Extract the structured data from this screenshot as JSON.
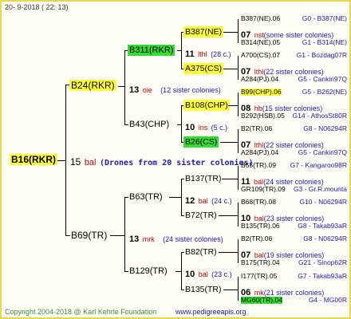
{
  "header": {
    "text": "20-   9-2018 (  22:  13)"
  },
  "footer": {
    "copyright": "Copyright 2004-2018 @ Karl Kehrle Foundation",
    "site": "www.pedigreeapis.org"
  },
  "root": {
    "name": "B16(RKR)",
    "num": "15",
    "code": "bal",
    "note": "(Drones from 20 sister colonies)"
  },
  "gen1": [
    {
      "name": "B24(RKR)",
      "num": "13",
      "code": "oie",
      "note": "(12 sister colonies)"
    },
    {
      "name": "B69(TR)",
      "num": "13",
      "code": "mrk",
      "note": "(24 sister colonies)"
    }
  ],
  "gen2": [
    {
      "name": "B311(RKR)",
      "num": "11",
      "code": "lthl",
      "note": "(28 c.)"
    },
    {
      "name": "B43(CHP)",
      "num": "10",
      "code": "ins",
      "note": "(5 c.)"
    },
    {
      "name": "B63(TR)",
      "num": "12",
      "code": "bal",
      "note": "(24 c.)"
    },
    {
      "name": "B129(TR)",
      "num": "10",
      "code": "bal",
      "note": "(23 c.)"
    }
  ],
  "gen3": [
    {
      "name": "B387(NE)"
    },
    {
      "name": "A375(CS)"
    },
    {
      "name": "B108(CHP)"
    },
    {
      "name": "B26(CS)"
    },
    {
      "name": "B137(TR)"
    },
    {
      "name": "B72(TR)"
    },
    {
      "name": "B82(TR)"
    },
    {
      "name": "B135(TR)"
    }
  ],
  "gen4": [
    {
      "top": "B387(NE).06",
      "topg": "G0 - B387(NE)",
      "num": "07",
      "code": "nst",
      "note": "(some sister colonies)",
      "bot": "B314(NE).05",
      "botg": "G1 - B314(NE)"
    },
    {
      "top": "A700(CS).07",
      "topg": "G1 - Bozdag07R",
      "num": "07",
      "code": "lthl",
      "note": "(22 sister colonies)",
      "bot": "A284(PJ).04",
      "botg": "G5 - Cankiri97Q"
    },
    {
      "top": "B99(CHP).06",
      "topg": "G5 - B262(NE)",
      "num": "08",
      "code": "hb",
      "note": "(15 sister colonies)",
      "bot": "B292(HSB).05",
      "botg": "G14 - AthosSt80R"
    },
    {
      "top": "B2(TR).06",
      "topg": "G8 - N06294R",
      "num": "07",
      "code": "lthl",
      "note": "(22 sister colonies)",
      "bot": "A284(PJ).04",
      "botg": "G5 - Cankiri97Q"
    },
    {
      "top": "B55(TR).09",
      "topg": "G7 - Kangaroo98R",
      "num": "11",
      "code": "bal",
      "note": "(24 sister colonies)",
      "bot": "GR109(TR).09",
      "botg": "G3 - Gr.R.mounta"
    },
    {
      "top": "B68(TR).08",
      "topg": "G10 - N06294R",
      "num": "10",
      "code": "bal",
      "note": "(23 sister colonies)",
      "bot": "B135(TR).06",
      "botg": "G8 - Takab93aR"
    },
    {
      "top": "B2(TR).06",
      "topg": "G8 - N06294R",
      "num": "07",
      "code": "bal",
      "note": "(19 sister colonies)",
      "bot": "B175(TR).04",
      "botg": "G21 - Sinop62R"
    },
    {
      "top": "I177(TR).05",
      "topg": "G7 - Takab93aR",
      "num": "06",
      "code": "mk",
      "note": "(21 sister colonies)",
      "bot": "MG60(TR).04",
      "botg": "G4 - MG00R"
    }
  ]
}
